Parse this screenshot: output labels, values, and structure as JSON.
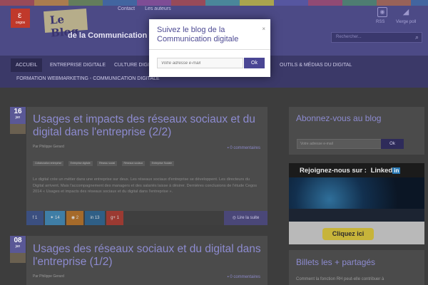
{
  "header": {
    "logo_text": "cegos",
    "top_links": [
      "Contact",
      "Les auteurs"
    ],
    "blog_badge": "Le Blog",
    "blog_subtitle": "de la Communication",
    "rss_label": "RSS",
    "voice_label": "Vierge poll",
    "search_placeholder": "Rechercher..."
  },
  "nav": {
    "items": [
      "ACCUEIL",
      "ENTREPRISE DIGITALE",
      "CULTURE DIGITALE",
      "OUTILS & MÉDIAS DU DIGITAL",
      "FORMATION WEBMARKETING - COMMUNICATION DIGITALE"
    ]
  },
  "modal": {
    "title": "Suivez le blog de la Communication digitale",
    "close_icon": "×",
    "input_placeholder": "Votre adresse e-mail",
    "button_label": "Ok"
  },
  "posts": [
    {
      "day": "16",
      "month": "jan",
      "title": "Usages et impacts des réseaux sociaux et du digital dans l'entreprise (2/2)",
      "author": "Par Philippe Gerard",
      "comments": "0 commentaires",
      "tags": [
        "Collaboration entreprise",
        "Entreprise digitale",
        "Réseau social",
        "Réseaux sociaux",
        "Entreprise Sociale"
      ],
      "excerpt": "Le digital crée un métier dans une entreprise sur deux. Les réseaux sociaux d'entreprise se développent. Les directeurs du Digital arrivent. Mais l'accompagnement des managers et des salariés laisse à désirer. Dernières conclusions de l'étude Cegos 2014 « Usages et impacts des réseaux sociaux et du digital dans l'entreprise ».",
      "shares": {
        "facebook": "1",
        "twitter": "14",
        "rss": "2",
        "linkedin": "13",
        "googleplus": "1"
      },
      "read_more": "Lire la suite"
    },
    {
      "day": "08",
      "month": "jan",
      "title": "Usages des réseaux sociaux et du digital dans l'entreprise (1/2)",
      "author": "Par Philippe Gerard",
      "comments": "0 commentaires"
    }
  ],
  "sidebar": {
    "subscribe_title": "Abonnez-vous au blog",
    "subscribe_placeholder": "Votre adresse e-mail",
    "subscribe_button": "Ok",
    "join_label": "Rejoignez-nous sur :",
    "linkedin_label": "Linked",
    "linkedin_in": "in",
    "cta": "Cliquez ici",
    "top_shared_title": "Billets les + partagés",
    "top_shared_first": "Comment la fonction RH peut-elle contribuer à"
  },
  "colors": {
    "header_bg": "#4c4a86",
    "nav_bg": "#3b3968",
    "accent": "#4a4694",
    "title_purple": "#8d8bd0"
  }
}
